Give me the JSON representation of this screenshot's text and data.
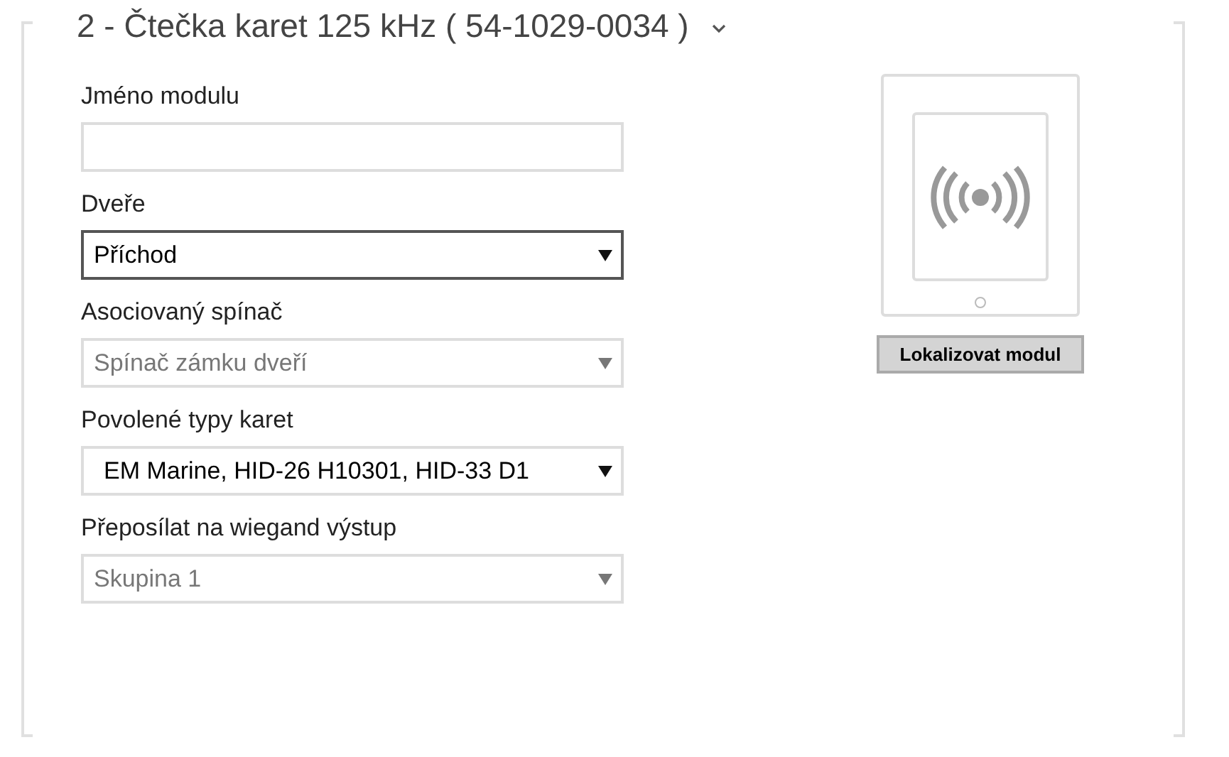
{
  "section": {
    "title": "2 - Čtečka karet 125 kHz ( 54-1029-0034 )",
    "expanded": true
  },
  "fields": [
    {
      "kind": "text",
      "label": "Jméno modulu",
      "disabled": false,
      "focused": false
    },
    {
      "kind": "select",
      "label": "Dveře",
      "value": "Příchod",
      "disabled": false,
      "focused": true
    },
    {
      "kind": "select",
      "label": "Asociovaný spínač",
      "value": "Spínač zámku dveří",
      "disabled": true,
      "focused": false
    },
    {
      "kind": "select",
      "label": "Povolené typy karet",
      "value": "EM Marine, HID-26 H10301, HID-33 D1",
      "disabled": false,
      "focused": false
    },
    {
      "kind": "select",
      "label": "Přeposílat na wiegand výstup",
      "value": "Skupina 1",
      "disabled": true,
      "focused": false
    }
  ],
  "locate_button": "Lokalizovat modul"
}
